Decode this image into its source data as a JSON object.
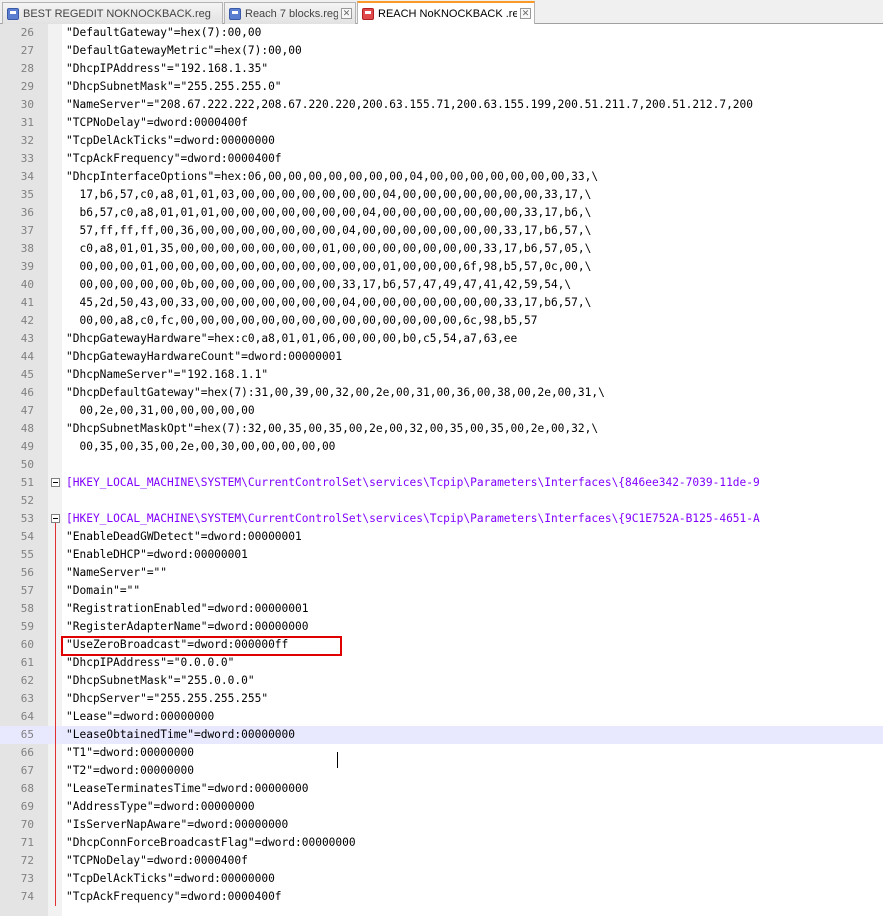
{
  "tabs": [
    {
      "label": "BEST REGEDIT NOKNOCKBACK.reg",
      "active": false,
      "icon": "blue-file-icon"
    },
    {
      "label": "Reach 7 blocks.reg",
      "active": false,
      "icon": "blue-file-icon"
    },
    {
      "label": "REACH NoKNOCKBACK .reg",
      "active": true,
      "icon": "red-file-icon"
    }
  ],
  "close_glyph": "✕",
  "colors": {
    "header_text": "#8000ff",
    "highlight_box": "#e00000",
    "active_tab_accent": "#fa9b28",
    "caret_line": "#e8e8ff"
  },
  "lines": [
    {
      "n": "26",
      "text": "\"DefaultGateway\"=hex(7):00,00"
    },
    {
      "n": "27",
      "text": "\"DefaultGatewayMetric\"=hex(7):00,00"
    },
    {
      "n": "28",
      "text": "\"DhcpIPAddress\"=\"192.168.1.35\""
    },
    {
      "n": "29",
      "text": "\"DhcpSubnetMask\"=\"255.255.255.0\""
    },
    {
      "n": "30",
      "text": "\"NameServer\"=\"208.67.222.222,208.67.220.220,200.63.155.71,200.63.155.199,200.51.211.7,200.51.212.7,200"
    },
    {
      "n": "31",
      "text": "\"TCPNoDelay\"=dword:0000400f"
    },
    {
      "n": "32",
      "text": "\"TcpDelAckTicks\"=dword:00000000"
    },
    {
      "n": "33",
      "text": "\"TcpAckFrequency\"=dword:0000400f"
    },
    {
      "n": "34",
      "text": "\"DhcpInterfaceOptions\"=hex:06,00,00,00,00,00,00,00,04,00,00,00,00,00,00,00,33,\\"
    },
    {
      "n": "35",
      "text": "  17,b6,57,c0,a8,01,01,03,00,00,00,00,00,00,00,04,00,00,00,00,00,00,00,33,17,\\"
    },
    {
      "n": "36",
      "text": "  b6,57,c0,a8,01,01,01,00,00,00,00,00,00,00,04,00,00,00,00,00,00,00,33,17,b6,\\"
    },
    {
      "n": "37",
      "text": "  57,ff,ff,ff,00,36,00,00,00,00,00,00,00,04,00,00,00,00,00,00,00,33,17,b6,57,\\"
    },
    {
      "n": "38",
      "text": "  c0,a8,01,01,35,00,00,00,00,00,00,00,01,00,00,00,00,00,00,00,33,17,b6,57,05,\\"
    },
    {
      "n": "39",
      "text": "  00,00,00,01,00,00,00,00,00,00,00,00,00,00,00,01,00,00,00,6f,98,b5,57,0c,00,\\"
    },
    {
      "n": "40",
      "text": "  00,00,00,00,00,0b,00,00,00,00,00,00,00,33,17,b6,57,47,49,47,41,42,59,54,\\"
    },
    {
      "n": "41",
      "text": "  45,2d,50,43,00,33,00,00,00,00,00,00,00,04,00,00,00,00,00,00,00,33,17,b6,57,\\"
    },
    {
      "n": "42",
      "text": "  00,00,a8,c0,fc,00,00,00,00,00,00,00,00,00,00,00,00,00,00,6c,98,b5,57"
    },
    {
      "n": "43",
      "text": "\"DhcpGatewayHardware\"=hex:c0,a8,01,01,06,00,00,00,b0,c5,54,a7,63,ee"
    },
    {
      "n": "44",
      "text": "\"DhcpGatewayHardwareCount\"=dword:00000001"
    },
    {
      "n": "45",
      "text": "\"DhcpNameServer\"=\"192.168.1.1\""
    },
    {
      "n": "46",
      "text": "\"DhcpDefaultGateway\"=hex(7):31,00,39,00,32,00,2e,00,31,00,36,00,38,00,2e,00,31,\\"
    },
    {
      "n": "47",
      "text": "  00,2e,00,31,00,00,00,00,00"
    },
    {
      "n": "48",
      "text": "\"DhcpSubnetMaskOpt\"=hex(7):32,00,35,00,35,00,2e,00,32,00,35,00,35,00,2e,00,32,\\"
    },
    {
      "n": "49",
      "text": "  00,35,00,35,00,2e,00,30,00,00,00,00,00"
    },
    {
      "n": "50",
      "text": ""
    },
    {
      "n": "51",
      "text": "[HKEY_LOCAL_MACHINE\\SYSTEM\\CurrentControlSet\\services\\Tcpip\\Parameters\\Interfaces\\{846ee342-7039-11de-9"
    },
    {
      "n": "52",
      "text": ""
    },
    {
      "n": "53",
      "text": "[HKEY_LOCAL_MACHINE\\SYSTEM\\CurrentControlSet\\services\\Tcpip\\Parameters\\Interfaces\\{9C1E752A-B125-4651-A"
    },
    {
      "n": "54",
      "text": "\"EnableDeadGWDetect\"=dword:00000001"
    },
    {
      "n": "55",
      "text": "\"EnableDHCP\"=dword:00000001"
    },
    {
      "n": "56",
      "text": "\"NameServer\"=\"\""
    },
    {
      "n": "57",
      "text": "\"Domain\"=\"\""
    },
    {
      "n": "58",
      "text": "\"RegistrationEnabled\"=dword:00000001"
    },
    {
      "n": "59",
      "text": "\"RegisterAdapterName\"=dword:00000000"
    },
    {
      "n": "60",
      "text": "\"UseZeroBroadcast\"=dword:000000ff"
    },
    {
      "n": "61",
      "text": "\"DhcpIPAddress\"=\"0.0.0.0\""
    },
    {
      "n": "62",
      "text": "\"DhcpSubnetMask\"=\"255.0.0.0\""
    },
    {
      "n": "63",
      "text": "\"DhcpServer\"=\"255.255.255.255\""
    },
    {
      "n": "64",
      "text": "\"Lease\"=dword:00000000"
    },
    {
      "n": "65",
      "text": "\"LeaseObtainedTime\"=dword:00000000"
    },
    {
      "n": "66",
      "text": "\"T1\"=dword:00000000"
    },
    {
      "n": "67",
      "text": "\"T2\"=dword:00000000"
    },
    {
      "n": "68",
      "text": "\"LeaseTerminatesTime\"=dword:00000000"
    },
    {
      "n": "69",
      "text": "\"AddressType\"=dword:00000000"
    },
    {
      "n": "70",
      "text": "\"IsServerNapAware\"=dword:00000000"
    },
    {
      "n": "71",
      "text": "\"DhcpConnForceBroadcastFlag\"=dword:00000000"
    },
    {
      "n": "72",
      "text": "\"TCPNoDelay\"=dword:0000400f"
    },
    {
      "n": "73",
      "text": "\"TcpDelAckTicks\"=dword:00000000"
    },
    {
      "n": "74",
      "text": "\"TcpAckFrequency\"=dword:0000400f"
    }
  ]
}
